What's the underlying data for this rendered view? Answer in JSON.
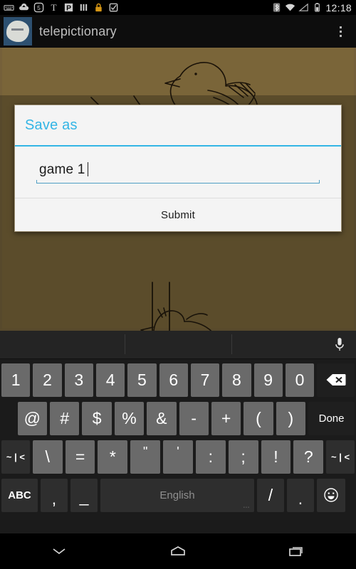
{
  "status_bar": {
    "time": "12:18",
    "left_icons": [
      {
        "name": "keyboard-icon"
      },
      {
        "name": "cloud-upload-icon"
      },
      {
        "name": "badge-5-icon"
      },
      {
        "name": "nyt-t-icon"
      },
      {
        "name": "pocket-p-icon"
      },
      {
        "name": "bars-icon"
      },
      {
        "name": "lock-icon"
      },
      {
        "name": "checkbox-icon"
      }
    ],
    "right_icons": [
      {
        "name": "bluetooth-icon"
      },
      {
        "name": "wifi-icon"
      },
      {
        "name": "cell-signal-icon"
      },
      {
        "name": "battery-icon"
      }
    ]
  },
  "action_bar": {
    "app_title": "telepictionary",
    "logo_name": "app-logo-icon",
    "overflow_name": "overflow-menu-button"
  },
  "canvas": {
    "name": "drawing-canvas",
    "background_color": "#7a6539",
    "stroke_color": "#1a1208",
    "description": "hand-drawn bird sketch"
  },
  "dialog": {
    "title": "Save as",
    "accent_color": "#33b5e5",
    "background_color": "#f4f4f4",
    "input": {
      "value": "game 1",
      "placeholder": "",
      "underline_color": "#4f9ec4"
    },
    "submit_label": "Submit"
  },
  "keyboard": {
    "suggestion_strip": {
      "mic_icon": "microphone-icon",
      "suggestions": [
        "",
        "",
        ""
      ]
    },
    "rows": [
      {
        "name": "number-row",
        "keys": [
          {
            "label": "1",
            "type": "char"
          },
          {
            "label": "2",
            "type": "char"
          },
          {
            "label": "3",
            "type": "char"
          },
          {
            "label": "4",
            "type": "char"
          },
          {
            "label": "5",
            "type": "char"
          },
          {
            "label": "6",
            "type": "char"
          },
          {
            "label": "7",
            "type": "char"
          },
          {
            "label": "8",
            "type": "char"
          },
          {
            "label": "9",
            "type": "char"
          },
          {
            "label": "0",
            "type": "char"
          },
          {
            "label": "",
            "type": "backspace",
            "icon": "backspace-icon"
          }
        ]
      },
      {
        "name": "symbol-row-1",
        "keys": [
          {
            "label": "@",
            "type": "char"
          },
          {
            "label": "#",
            "type": "char"
          },
          {
            "label": "$",
            "type": "char"
          },
          {
            "label": "%",
            "type": "char"
          },
          {
            "label": "&",
            "type": "char"
          },
          {
            "label": "-",
            "type": "char"
          },
          {
            "label": "+",
            "type": "char"
          },
          {
            "label": "(",
            "type": "char"
          },
          {
            "label": ")",
            "type": "char"
          },
          {
            "label": "Done",
            "type": "action"
          }
        ]
      },
      {
        "name": "symbol-row-2",
        "keys": [
          {
            "label": "~ | <",
            "type": "shift"
          },
          {
            "label": "\\",
            "type": "char"
          },
          {
            "label": "=",
            "type": "char"
          },
          {
            "label": "*",
            "type": "char"
          },
          {
            "label": "\"",
            "type": "char"
          },
          {
            "label": "'",
            "type": "char"
          },
          {
            "label": ":",
            "type": "char"
          },
          {
            "label": ";",
            "type": "char"
          },
          {
            "label": "!",
            "type": "char"
          },
          {
            "label": "?",
            "type": "char"
          },
          {
            "label": "~ | <",
            "type": "shift"
          }
        ]
      },
      {
        "name": "bottom-row",
        "keys": [
          {
            "label": "ABC",
            "type": "mode"
          },
          {
            "label": ",",
            "type": "char"
          },
          {
            "label": "_",
            "type": "char"
          },
          {
            "label": "English",
            "type": "space"
          },
          {
            "label": "/",
            "type": "char"
          },
          {
            "label": ".",
            "type": "char"
          },
          {
            "label": "",
            "type": "emoji",
            "icon": "emoji-smiley-icon"
          }
        ]
      }
    ]
  },
  "nav_bar": {
    "buttons": [
      {
        "name": "hide-keyboard-button",
        "icon": "chevron-down-icon"
      },
      {
        "name": "home-button",
        "icon": "home-icon"
      },
      {
        "name": "recents-button",
        "icon": "recents-icon"
      }
    ]
  }
}
